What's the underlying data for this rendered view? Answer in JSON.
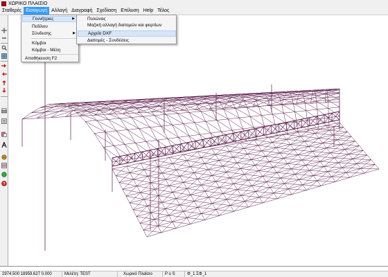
{
  "window": {
    "title": "ΧΩΡΙΚΟ ΠΛΑΙΣΙΟ"
  },
  "menubar": {
    "items": [
      "Σταθερές",
      "Εισαγωγή",
      "Αλλαγή",
      "Διαγραφή",
      "Σχεδίαση",
      "Επίλυση",
      "Help",
      "Τέλος"
    ]
  },
  "dropdown": {
    "items": [
      "Γεννήτριες",
      "Πεδίλου",
      "Σύνδεσης",
      "Κόμβοι",
      "Κόμβοι - Μέλη",
      "Αποθήκευση  F2"
    ]
  },
  "submenu": {
    "items": [
      "Πυλώνας",
      "Μαζική αλλαγή διατομών και φορτίων",
      "Αρχείο DXF",
      "Διατομές - Συνδέσεις"
    ]
  },
  "toolbar": {
    "icons": [
      "move-icon",
      "minus-icon",
      "zoom-icon",
      "grid-icon",
      "arrow-right-icon",
      "arrow-left-icon",
      "arrow-up-icon",
      "arrow-down-icon",
      "print-icon",
      "list-icon",
      "paste-icon",
      "text-a-icon",
      "load-icon",
      "layers-icon",
      "globe-icon",
      "help-icon"
    ]
  },
  "statusbar": {
    "coords": "2974.500 18959.627 0.000",
    "study": "Μελέτη: TEST",
    "type": "Χωρικό Πλαίσιο",
    "pos": "P o S",
    "phi": "Φ_1  ΣΦ_1"
  },
  "colors": {
    "structure": "#5a1a4a",
    "menu_highlight": "#3399ff",
    "item_highlight": "#d7e6f7"
  }
}
